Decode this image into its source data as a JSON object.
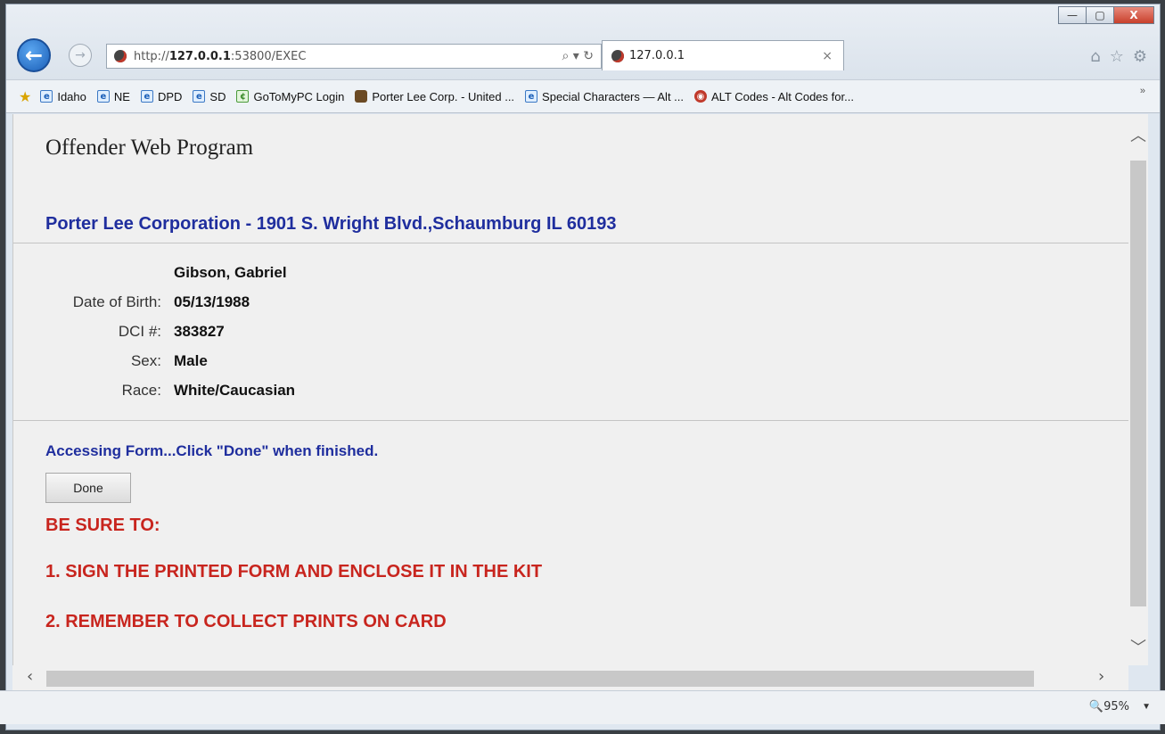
{
  "browser": {
    "window_controls": {
      "minimize": "—",
      "maximize": "▢",
      "close": "X"
    },
    "address": {
      "prefix": "http://",
      "host": "127.0.0.1",
      "rest": ":53800/EXEC",
      "tools": "⌕ ▾ ↻"
    },
    "tab": {
      "label": "127.0.0.1",
      "close": "×"
    },
    "right_icons": [
      "home-icon",
      "star-icon",
      "gear-icon"
    ],
    "favorites": [
      {
        "label": "Idaho",
        "icon": "ie-page-icon"
      },
      {
        "label": "NE",
        "icon": "ie-page-icon"
      },
      {
        "label": "DPD",
        "icon": "ie-page-icon"
      },
      {
        "label": "SD",
        "icon": "ie-page-icon"
      },
      {
        "label": "GoToMyPC Login",
        "icon": "gotomypc-icon"
      },
      {
        "label": "Porter Lee Corp. - United ...",
        "icon": "porter-lee-icon"
      },
      {
        "label": "Special Characters — Alt ...",
        "icon": "ie-page-icon"
      },
      {
        "label": "ALT Codes - Alt Codes for...",
        "icon": "alt-codes-icon"
      }
    ],
    "favorites_more": "»",
    "zoom": "95%"
  },
  "page": {
    "title": "Offender Web Program",
    "org_line": "Porter Lee Corporation - 1901 S. Wright Blvd.,Schaumburg IL 60193",
    "offender": {
      "name": "Gibson, Gabriel",
      "rows": [
        {
          "label": "Date of Birth:",
          "value": "05/13/1988"
        },
        {
          "label": "DCI #:",
          "value": "383827"
        },
        {
          "label": "Sex:",
          "value": "Male"
        },
        {
          "label": "Race:",
          "value": "White/Caucasian"
        }
      ]
    },
    "access_message": "Accessing Form...Click \"Done\" when finished.",
    "done_button": "Done",
    "warnings": {
      "heading": "BE SURE TO:",
      "item1": "1. SIGN THE PRINTED FORM AND ENCLOSE IT IN THE KIT",
      "item2": "2. REMEMBER TO COLLECT PRINTS ON CARD"
    }
  },
  "colors": {
    "link_blue": "#1f2e9e",
    "warning_red": "#c8251e"
  }
}
